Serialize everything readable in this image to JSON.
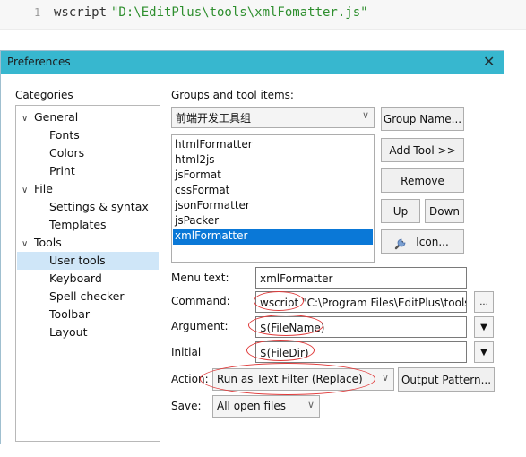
{
  "code": {
    "line_number": "1",
    "keyword": "wscript",
    "string": "\"D:\\EditPlus\\tools\\xmlFomatter.js\""
  },
  "dialog": {
    "title": "Preferences",
    "close_glyph": "✕"
  },
  "categories": {
    "label": "Categories",
    "items": [
      {
        "label": "General",
        "expanded": true
      },
      {
        "label": "Fonts"
      },
      {
        "label": "Colors"
      },
      {
        "label": "Print"
      },
      {
        "label": "File",
        "expanded": true
      },
      {
        "label": "Settings & syntax"
      },
      {
        "label": "Templates"
      },
      {
        "label": "Tools",
        "expanded": true
      },
      {
        "label": "User tools",
        "selected": true
      },
      {
        "label": "Keyboard"
      },
      {
        "label": "Spell checker"
      },
      {
        "label": "Toolbar"
      },
      {
        "label": "Layout"
      }
    ],
    "chevron": "∨"
  },
  "groups": {
    "label": "Groups and tool items:",
    "selected_group": "前端开发工具组",
    "tools": [
      "htmlFormatter",
      "html2js",
      "jsFormat",
      "cssFormat",
      "jsonFormatter",
      "jsPacker",
      "xmlFormatter"
    ],
    "selected_tool": "xmlFormatter"
  },
  "buttons": {
    "group_name": "Group Name...",
    "add_tool": "Add Tool >>",
    "remove": "Remove",
    "up": "Up",
    "down": "Down",
    "icon": "Icon...",
    "browse": "...",
    "output_pattern": "Output Pattern..."
  },
  "fields": {
    "menu_text_label": "Menu text:",
    "menu_text_value": "xmlFormatter",
    "command_label": "Command:",
    "command_value": "wscript \"C:\\Program Files\\EditPlus\\tools",
    "argument_label": "Argument:",
    "argument_value": "$(FileName)",
    "initial_label": "Initial",
    "initial_value": "$(FileDir)",
    "action_label": "Action:",
    "action_value": "Run as Text Filter (Replace)",
    "save_label": "Save:",
    "save_value": "All open files"
  },
  "colors": {
    "titlebar": "#37b7cf",
    "selection": "#0a78d7",
    "tree_selection": "#cfe6f8",
    "highlight_oval": "#e03a3a"
  },
  "icons": {
    "close": "close-icon",
    "chevron": "chevron-down-icon",
    "wrench": "wrench-icon"
  }
}
